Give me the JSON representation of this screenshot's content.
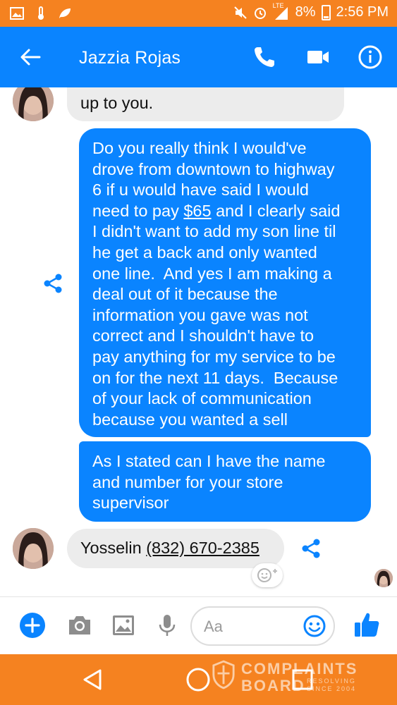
{
  "status_bar": {
    "battery": "8%",
    "time": "2:56 PM",
    "network": "LTE",
    "icons": [
      "gallery-icon",
      "thermometer-icon",
      "leaf-icon",
      "mute-icon",
      "alarm-icon",
      "signal-icon",
      "battery-icon"
    ]
  },
  "header": {
    "contact_name": "Jazzia Rojas",
    "icons": [
      "back-arrow-icon",
      "phone-icon",
      "video-icon",
      "info-icon"
    ]
  },
  "messages": [
    {
      "from": "them",
      "text": "up to you."
    },
    {
      "from": "me",
      "lines": [
        "Do you really think I would've",
        "drove from downtown to highway",
        "6 if u would have said I would",
        [
          "need to pay ",
          "$65",
          " and I clearly said"
        ],
        "I didn't want to add my son line til",
        "he get a back and only wanted",
        "one line.  And yes I am making a",
        "deal out of it because the",
        "information you gave was not",
        "correct and I shouldn't have to",
        "pay anything for my service to be",
        "on for the next 11 days.  Because",
        "of your lack of communication",
        "because you wanted a sell"
      ]
    },
    {
      "from": "me",
      "lines": [
        "As I stated can I have the name",
        "and number for your store",
        "supervisor"
      ]
    },
    {
      "from": "them",
      "text_prefix": "Yosselin ",
      "link": "(832) 670-2385"
    }
  ],
  "composer": {
    "placeholder": "Aa",
    "icons": [
      "add-icon",
      "camera-icon",
      "image-icon",
      "microphone-icon",
      "emoji-icon",
      "thumbs-up-icon"
    ]
  },
  "nav_bar": {
    "icons": [
      "back-icon",
      "home-icon",
      "recents-icon"
    ]
  },
  "watermark": {
    "line1": "COMPLAINTS",
    "line2": "BOARD",
    "tag1": "RESOLVING",
    "tag2": "SINCE 2004"
  },
  "colors": {
    "accent": "#0a84ff",
    "status_bar": "#f58220",
    "incoming_bubble": "#ececec"
  }
}
